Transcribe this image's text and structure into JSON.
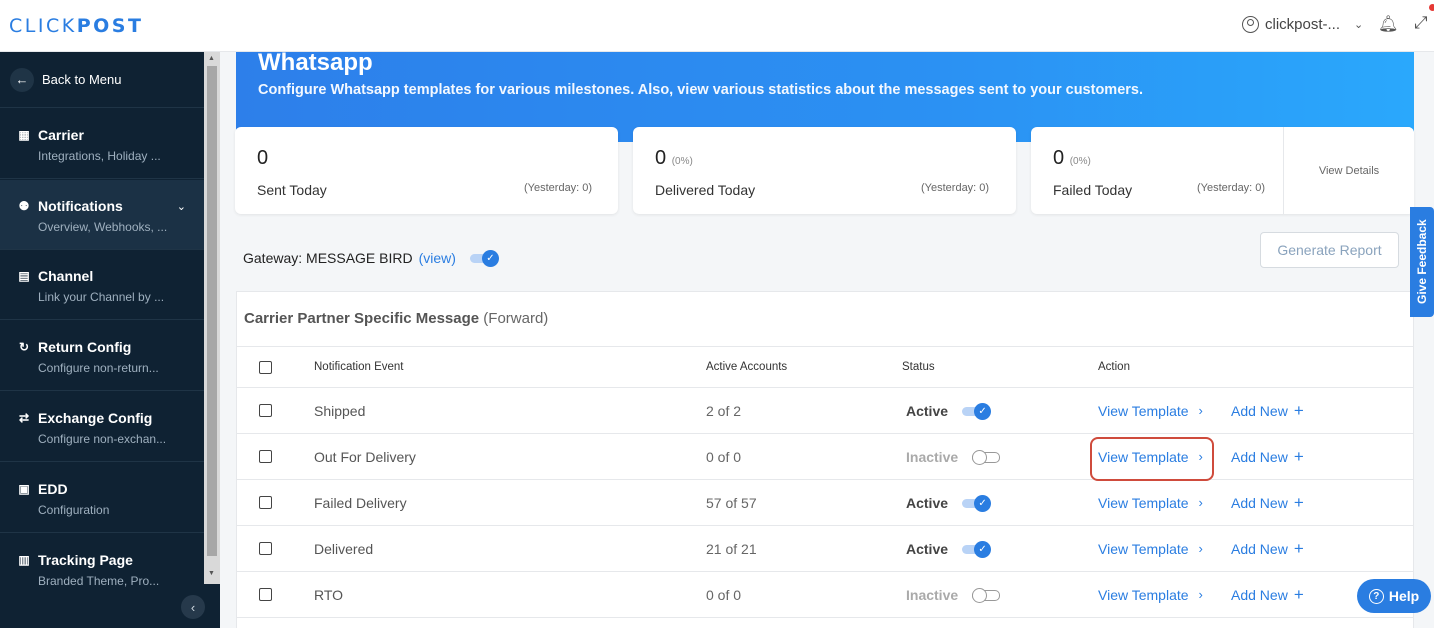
{
  "app": {
    "logo_light": "CLICK",
    "logo_bold": "POST"
  },
  "topbar": {
    "user_label": "clickpost-...",
    "icons": [
      "user-icon",
      "chevron-down-icon",
      "bell-icon",
      "expand-icon"
    ]
  },
  "sidebar": {
    "back_label": "Back to Menu",
    "items": [
      {
        "title": "Carrier",
        "subtitle": "Integrations, Holiday ..."
      },
      {
        "title": "Notifications",
        "subtitle": "Overview, Webhooks, ..."
      },
      {
        "title": "Channel",
        "subtitle": "Link your Channel by ..."
      },
      {
        "title": "Return Config",
        "subtitle": "Configure non-return..."
      },
      {
        "title": "Exchange Config",
        "subtitle": "Configure non-exchan..."
      },
      {
        "title": "EDD",
        "subtitle": "Configuration"
      },
      {
        "title": "Tracking Page",
        "subtitle": "Branded Theme, Pro..."
      }
    ]
  },
  "hero": {
    "title": "Whatsapp",
    "description": "Configure Whatsapp templates for various milestones. Also, view various statistics about the messages sent to your customers."
  },
  "stats": {
    "sent": {
      "value": "0",
      "label": "Sent Today",
      "yesterday": "(Yesterday: 0)"
    },
    "delivered": {
      "value": "0",
      "pct": "(0%)",
      "label": "Delivered Today",
      "yesterday": "(Yesterday: 0)"
    },
    "failed": {
      "value": "0",
      "pct": "(0%)",
      "label": "Failed Today",
      "yesterday": "(Yesterday: 0)"
    },
    "view_details": "View Details"
  },
  "gateway": {
    "label": "Gateway:",
    "value": "MESSAGE BIRD",
    "view_link": "(view)",
    "enabled": true
  },
  "generate_report": "Generate Report",
  "panel": {
    "title": "Carrier Partner Specific Message",
    "title_suffix": "(Forward)",
    "columns": {
      "event": "Notification Event",
      "accounts": "Active Accounts",
      "status": "Status",
      "action": "Action"
    },
    "rows": [
      {
        "event": "Shipped",
        "accounts": "2 of 2",
        "status": "Active",
        "view": "View Template",
        "add": "Add New"
      },
      {
        "event": "Out For Delivery",
        "accounts": "0 of 0",
        "status": "Inactive",
        "view": "View Template",
        "add": "Add New"
      },
      {
        "event": "Failed Delivery",
        "accounts": "57 of 57",
        "status": "Active",
        "view": "View Template",
        "add": "Add New"
      },
      {
        "event": "Delivered",
        "accounts": "21 of 21",
        "status": "Active",
        "view": "View Template",
        "add": "Add New"
      },
      {
        "event": "RTO",
        "accounts": "0 of 0",
        "status": "Inactive",
        "view": "View Template",
        "add": "Add New"
      }
    ]
  },
  "feedback_tab": "Give Feedback",
  "help_button": "Help"
}
